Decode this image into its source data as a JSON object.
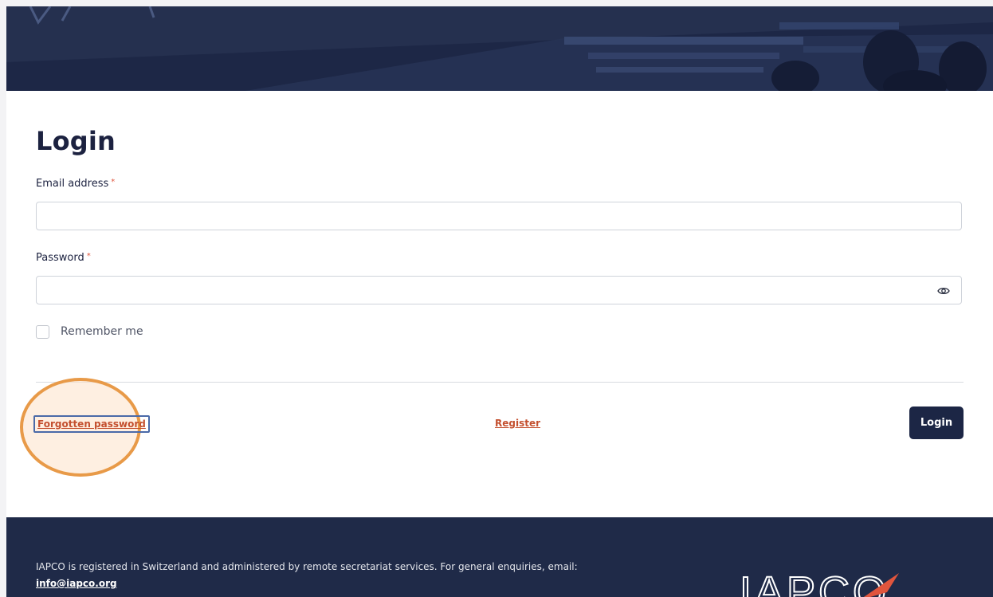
{
  "page": {
    "title": "Login"
  },
  "form": {
    "email_label": "Email address",
    "email_required": "*",
    "email_value": "",
    "password_label": "Password",
    "password_required": "*",
    "password_value": "",
    "remember_label": "Remember me",
    "remember_checked": false
  },
  "actions": {
    "forgot_label": "Forgotten password",
    "register_label": "Register",
    "login_label": "Login"
  },
  "footer": {
    "text": "IAPCO is registered in Switzerland and administered by remote secretariat services. For general enquiries, email:",
    "email": "info@iapco.org",
    "logo_text": "IAPCO"
  },
  "colors": {
    "brand_navy": "#1c2645",
    "link_orange": "#c4502f",
    "highlight": "#e89a48"
  },
  "icons": {
    "password_toggle": "eye-icon"
  }
}
